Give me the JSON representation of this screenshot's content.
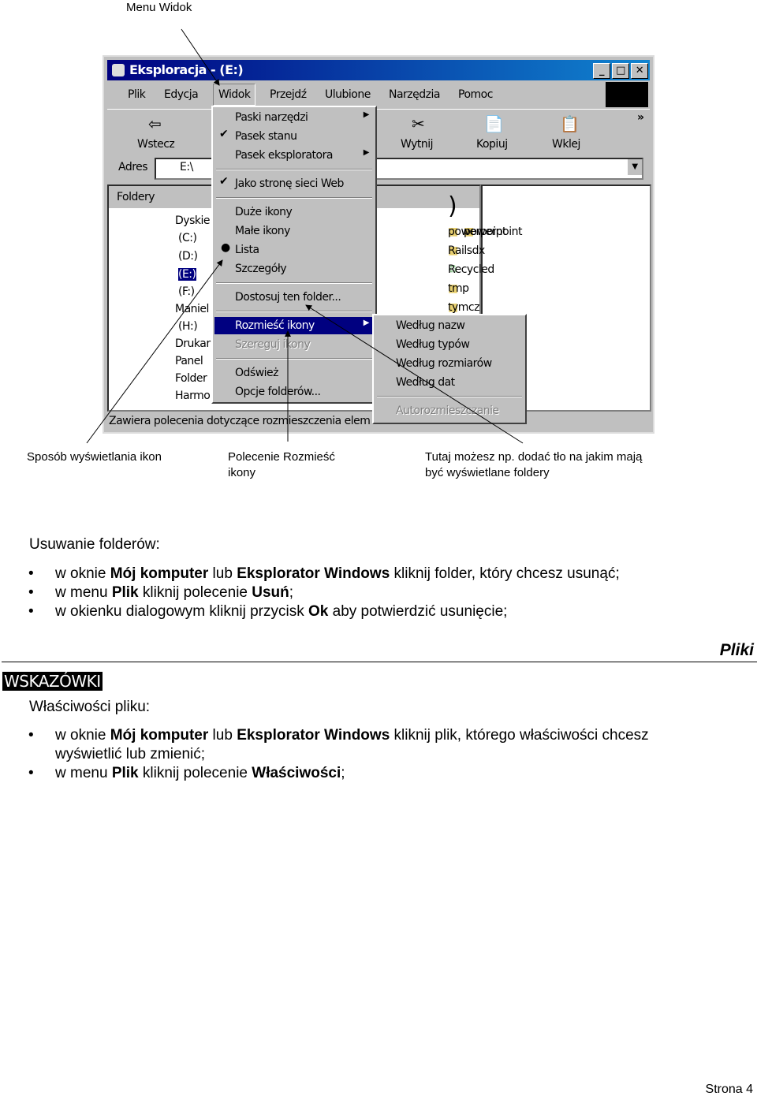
{
  "callouts": {
    "menu_widok": "Menu Widok",
    "icons_view": "Sposób wyświetlania ikon",
    "arrange": "Polecenie Rozmieść ikony",
    "background": "Tutaj możesz np. dodać tło na jakim mają być wyświetlane foldery"
  },
  "window": {
    "title": "Eksploracja - (E:)",
    "menu": [
      "Plik",
      "Edycja",
      "Widok",
      "Przejdź",
      "Ulubione",
      "Narzędzia",
      "Pomoc"
    ],
    "toolbar": {
      "back": "Wstecz",
      "cut": "Wytnij",
      "copy": "Kopiuj",
      "paste": "Wklej",
      "more": "»"
    },
    "address_label": "Adres",
    "address_value": "E:\\",
    "folders_header": "Foldery",
    "tree": [
      "Dyskie",
      "(C:)",
      "(D:)",
      "(E:)",
      "(F:)",
      "Maniel",
      "(H:)",
      "Drukar",
      "Panel",
      "Folder",
      "Harmo"
    ],
    "files": [
      "powerpoint",
      "Railsdx",
      "Recycled",
      "tmp",
      "tymcz"
    ],
    "status": "Zawiera polecenia dotyczące rozmieszczenia elem",
    "view_menu": [
      "Paski narzędzi",
      "Pasek stanu",
      "Pasek eksploratora",
      "Jako stronę sieci Web",
      "Duże ikony",
      "Małe ikony",
      "Lista",
      "Szczegóły",
      "Dostosuj ten folder...",
      "Rozmieść ikony",
      "Szereguj ikony",
      "Odśwież",
      "Opcje folderów..."
    ],
    "arrange_menu": [
      "Według nazw",
      "Według typów",
      "Według rozmiarów",
      "Według dat",
      "Autorozmieszczanie"
    ]
  },
  "delete": {
    "heading": "Usuwanie folderów:",
    "items": [
      [
        "w oknie ",
        "Mój komputer",
        " lub ",
        "Eksplorator Windows",
        " kliknij folder, który chcesz usunąć;"
      ],
      [
        "w menu ",
        "Plik",
        " kliknij polecenie ",
        "Usuń",
        ";"
      ],
      [
        "w okienku dialogowym kliknij przycisk ",
        "Ok",
        " aby potwierdzić usunięcie;"
      ]
    ]
  },
  "section": "Pliki",
  "tips_label": "WSKAZÓWKI",
  "props": {
    "heading": "Właściwości pliku:",
    "items": [
      [
        "w oknie ",
        "Mój komputer",
        " lub ",
        "Eksplorator Windows",
        " kliknij plik, którego właściwości chcesz wyświetlić lub zmienić;"
      ],
      [
        "w menu ",
        "Plik",
        " kliknij polecenie ",
        "Właściwości",
        ";"
      ]
    ]
  },
  "footer": "Strona 4"
}
